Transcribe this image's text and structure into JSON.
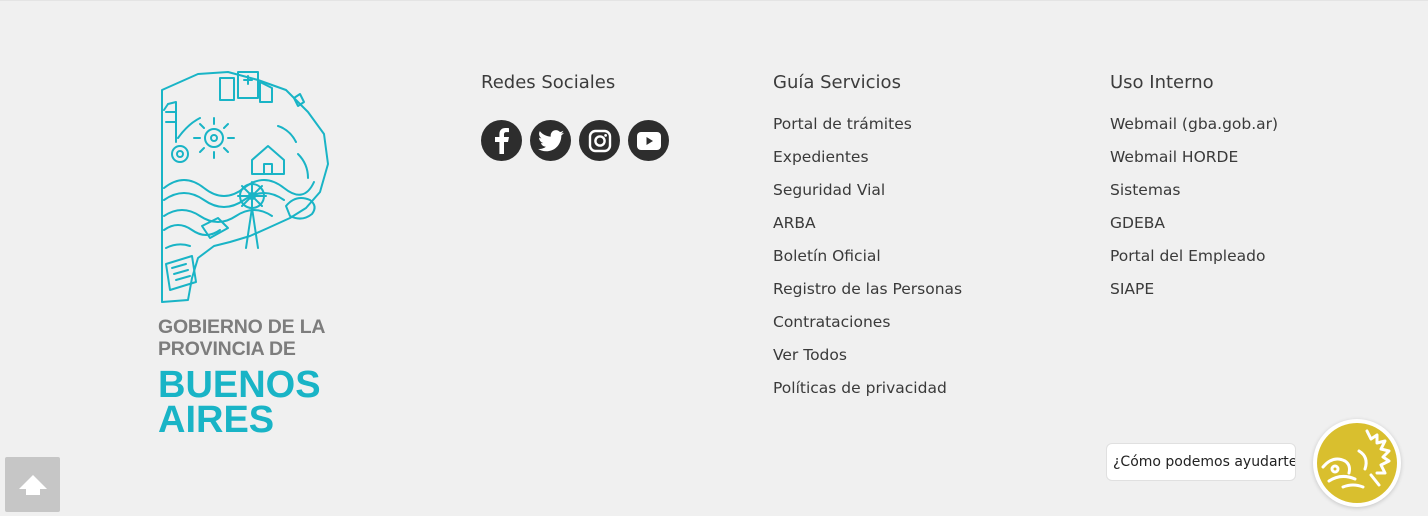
{
  "logo": {
    "line1": "GOBIERNO DE LA",
    "line2": "PROVINCIA DE",
    "line3": "BUENOS",
    "line4": "AIRES",
    "icon": "buenos-aires-province-map-icon",
    "colors": {
      "teal": "#19b4c6",
      "gray": "#7d7d7d"
    }
  },
  "redes": {
    "title": "Redes Sociales",
    "items": [
      {
        "icon": "facebook-icon"
      },
      {
        "icon": "twitter-icon"
      },
      {
        "icon": "instagram-icon"
      },
      {
        "icon": "youtube-icon"
      }
    ]
  },
  "servicios": {
    "title": "Guía Servicios",
    "links": [
      "Portal de trámites",
      "Expedientes",
      "Seguridad Vial",
      "ARBA",
      "Boletín Oficial",
      "Registro de las Personas",
      "Contrataciones",
      "Ver Todos",
      "Políticas de privacidad"
    ]
  },
  "interno": {
    "title": "Uso Interno",
    "links": [
      "Webmail (gba.gob.ar)",
      "Webmail HORDE",
      "Sistemas",
      "GDEBA",
      "Portal del Empleado",
      "SIAPE"
    ]
  },
  "back_to_top": {
    "icon": "arrow-up-icon"
  },
  "chat": {
    "prompt": "¿Cómo podemos ayudarte?",
    "avatar_icon": "chat-assistant-icon",
    "accent": "#d9bf2e"
  }
}
